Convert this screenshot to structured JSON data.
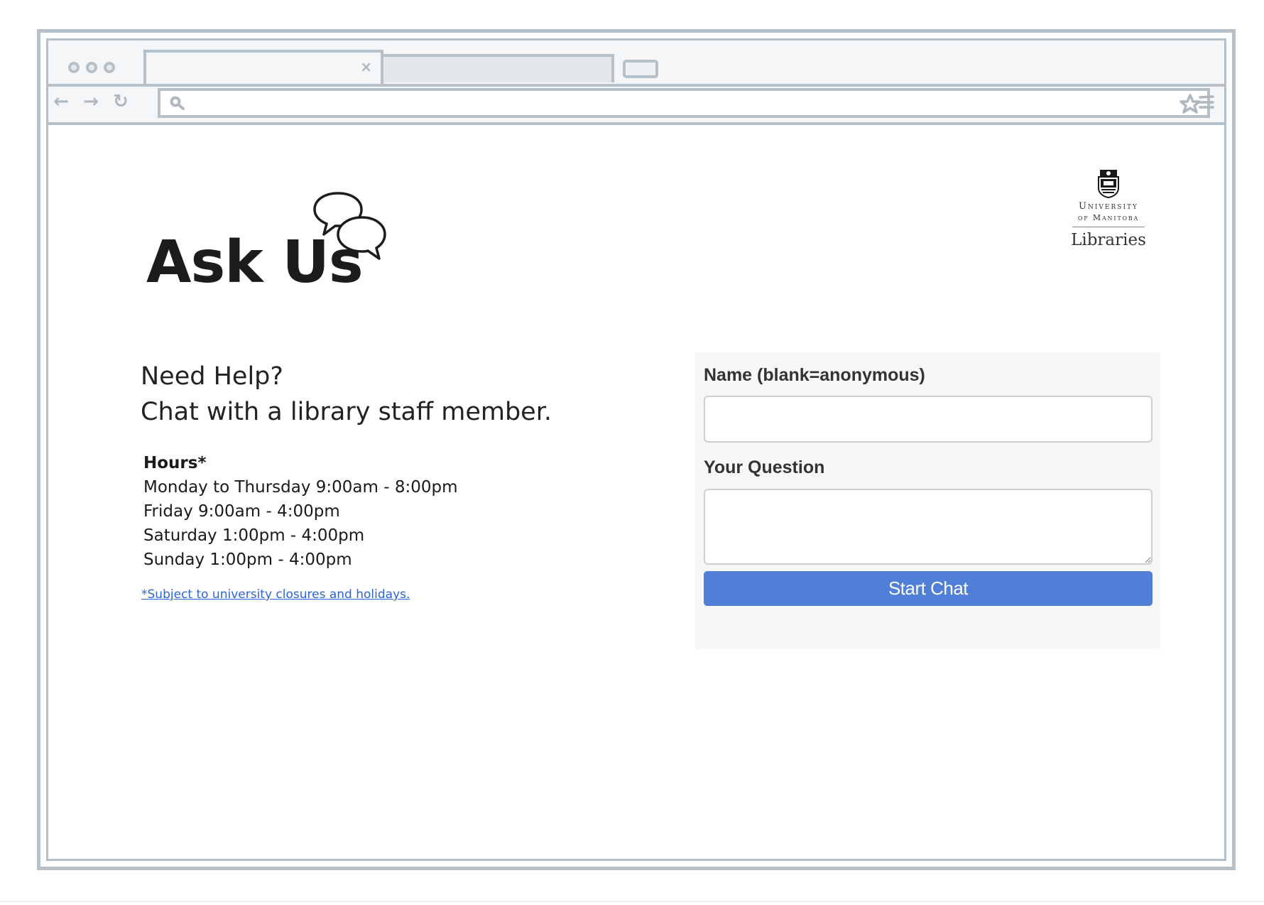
{
  "browser": {
    "tab_close_glyph": "×",
    "nav": {
      "back_glyph": "←",
      "forward_glyph": "→",
      "reload_glyph": "↻"
    },
    "icons": [
      "search-icon",
      "star-icon",
      "menu-icon",
      "chat-bubbles-icon"
    ],
    "frame_color": "#b6c0c8"
  },
  "header": {
    "title": "Ask Us"
  },
  "logo": {
    "line1": "University",
    "line2": "of Manitoba",
    "line3": "Libraries"
  },
  "intro": {
    "line1": "Need Help?",
    "line2": "Chat with a library staff member."
  },
  "hours": {
    "title": "Hours*",
    "rows": [
      "Monday to Thursday 9:00am - 8:00pm",
      "Friday 9:00am - 4:00pm",
      "Saturday 1:00pm - 4:00pm",
      "Sunday 1:00pm - 4:00pm"
    ],
    "note": "*Subject to university closures and holidays."
  },
  "chat_form": {
    "name_label": "Name (blank=anonymous)",
    "name_value": "",
    "question_label": "Your Question",
    "question_value": "",
    "start_button": "Start Chat",
    "button_color": "#4f7fd6",
    "panel_color": "#f7f7f7"
  }
}
